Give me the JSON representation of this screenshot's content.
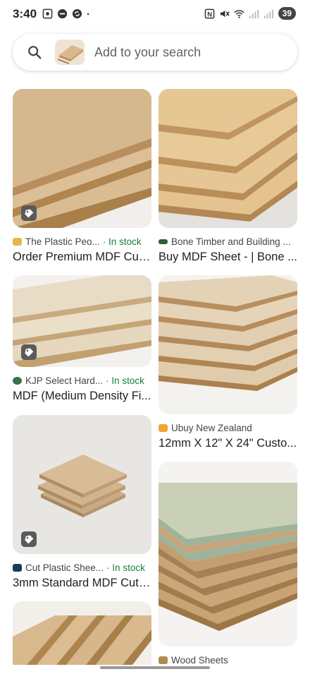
{
  "status_bar": {
    "time": "3:40",
    "battery": "39",
    "left_icons": [
      "screenshot-icon",
      "dnd-icon",
      "sync-icon",
      "dot-icon"
    ],
    "right_icons": [
      "nfc-icon",
      "mute-icon",
      "wifi-icon",
      "signal-icon",
      "signal-icon"
    ]
  },
  "search": {
    "placeholder": "Add to your search"
  },
  "results": [
    {
      "source": "The Plastic Peo...",
      "stock": "· In stock",
      "title": "Order Premium MDF Cut...",
      "fav_color": "#e8b64a",
      "has_tag": true
    },
    {
      "source": "Bone Timber and Building ...",
      "stock": "",
      "title": "Buy MDF Sheet - | Bone ...",
      "fav_color": "#2e5e3a",
      "has_tag": false
    },
    {
      "source": "KJP Select Hard...",
      "stock": "· In stock",
      "title": "MDF (Medium Density Fi...",
      "fav_color": "#3c6e4e",
      "has_tag": true
    },
    {
      "source": "Ubuy New Zealand",
      "stock": "",
      "title": "12mm X 12\" X 24\" Custo...",
      "fav_color": "#f0a62c",
      "has_tag": false
    },
    {
      "source": "Cut Plastic Shee...",
      "stock": "· In stock",
      "title": "3mm Standard MDF Cut ...",
      "fav_color": "#1a3b5c",
      "has_tag": true
    },
    {
      "source": "Wood Sheets",
      "stock": "",
      "title": "",
      "fav_color": "#b08a4e",
      "has_tag": false
    }
  ]
}
